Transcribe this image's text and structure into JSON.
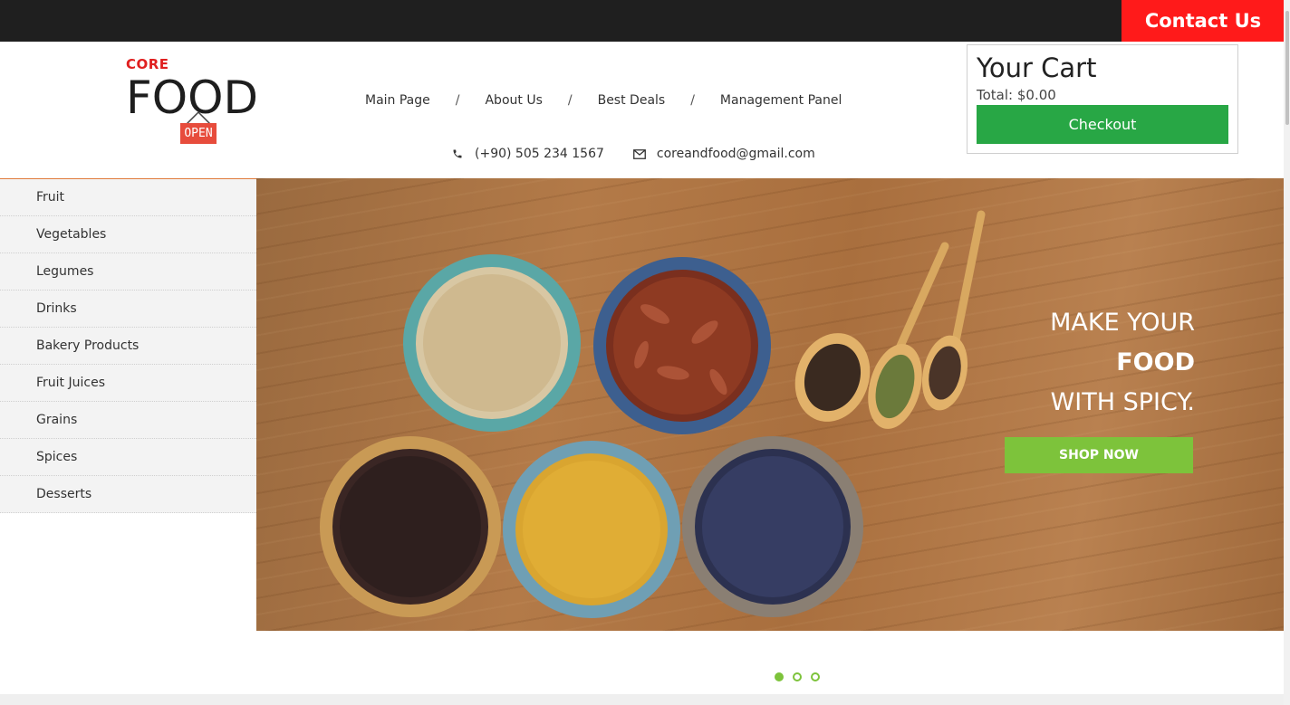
{
  "topbar": {
    "contact_label": "Contact Us"
  },
  "logo": {
    "core": "CORE",
    "food": "FOOD",
    "sign": "OPEN"
  },
  "nav": {
    "items": [
      "Main Page",
      "About Us",
      "Best Deals",
      "Management Panel"
    ],
    "separator": "/"
  },
  "contact": {
    "phone": "(+90) 505 234 1567",
    "email": "coreandfood@gmail.com"
  },
  "cart": {
    "title": "Your Cart",
    "total": "Total: $0.00",
    "checkout_label": "Checkout"
  },
  "categories": [
    "Fruit",
    "Vegetables",
    "Legumes",
    "Drinks",
    "Bakery Products",
    "Fruit Juices",
    "Grains",
    "Spices",
    "Desserts"
  ],
  "hero": {
    "line1": "MAKE YOUR",
    "line2": "FOOD",
    "line3": "WITH SPICY.",
    "cta_label": "SHOP NOW"
  },
  "slider": {
    "slide_count": 3,
    "active_index": 0
  },
  "colors": {
    "topbar": "#1f1f1f",
    "contact": "#ff1a1a",
    "checkout": "#28a745",
    "accent_green": "#7dc33b",
    "logo_red": "#e02020"
  },
  "icons": {
    "phone": "phone-icon",
    "email": "envelope-icon"
  }
}
